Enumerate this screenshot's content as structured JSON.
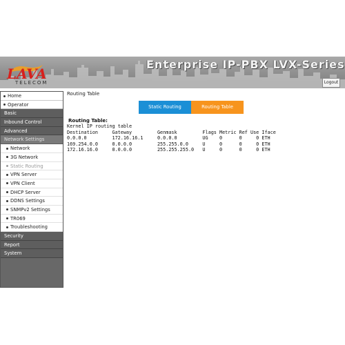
{
  "header": {
    "title": "Enterprise IP-PBX LVX-Series",
    "logo_word": "LAVA",
    "logo_sub": "TELECOM",
    "logout_label": "Logout"
  },
  "sidebar": {
    "home": "Home",
    "operator": "Operator",
    "basic": "Basic",
    "inbound_control": "Inbound Control",
    "advanced": "Advanced",
    "network_settings": "Network Settings",
    "sub_items": [
      "Network",
      "3G Network",
      "Static Routing",
      "VPN Server",
      "VPN Client",
      "DHCP Server",
      "DDNS Settings",
      "SNMPv2 Settings",
      "TR069",
      "Troubleshooting"
    ],
    "active_sub": "Static Routing",
    "security": "Security",
    "report": "Report",
    "system": "System"
  },
  "main": {
    "page_title": "Routing Table",
    "tabs": {
      "static_routing": "Static Routing",
      "routing_table": "Routing Table"
    },
    "heading": "Routing Table:",
    "kernel_line": "Kernel IP routing table",
    "columns": [
      "Destination",
      "Gateway",
      "Genmask",
      "Flags",
      "Metric",
      "Ref",
      "Use",
      "Iface"
    ],
    "rows": [
      [
        "0.0.0.0",
        "172.16.16.1",
        "0.0.0.0",
        "UG",
        "0",
        "0",
        "0",
        "ETH"
      ],
      [
        "169.254.0.0",
        "0.0.0.0",
        "255.255.0.0",
        "U",
        "0",
        "0",
        "0",
        "ETH"
      ],
      [
        "172.16.16.0",
        "0.0.0.0",
        "255.255.255.0",
        "U",
        "0",
        "0",
        "0",
        "ETH"
      ]
    ]
  },
  "colors": {
    "tab_blue": "#1b8fd6",
    "tab_orange": "#f7941d",
    "logo_red": "#d8201c"
  }
}
